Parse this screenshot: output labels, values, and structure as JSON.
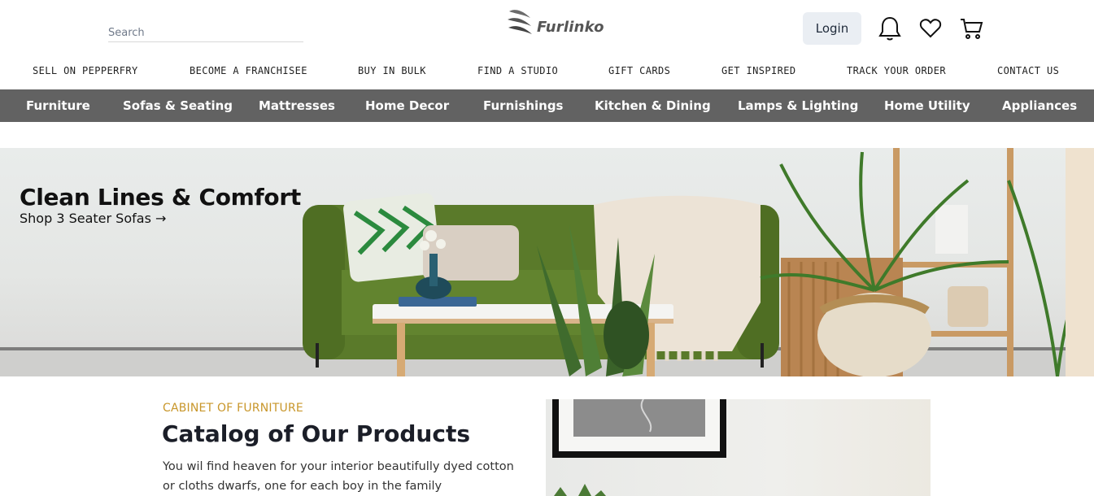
{
  "header": {
    "search_placeholder": "Search",
    "logo_text": "Furlinko",
    "login_label": "Login",
    "icons": [
      "bell-icon",
      "heart-icon",
      "cart-icon"
    ]
  },
  "top_links": [
    "SELL ON PEPPERFRY",
    "BECOME A FRANCHISEE",
    "BUY IN BULK",
    "FIND A STUDIO",
    "GIFT CARDS",
    "GET INSPIRED",
    "TRACK YOUR ORDER",
    "CONTACT US"
  ],
  "categories": [
    "Furniture",
    "Sofas & Seating",
    "Mattresses",
    "Home Decor",
    "Furnishings",
    "Kitchen & Dining",
    "Lamps & Lighting",
    "Home Utility",
    "Appliances"
  ],
  "hero": {
    "title": "Clean Lines & Comfort",
    "link_text": "Shop 3 Seater Sofas →"
  },
  "catalog": {
    "kicker": "CABINET OF FURNITURE",
    "title": "Catalog of Our Products",
    "description": "You wil find heaven for your interior beautifully dyed cotton or cloths dwarfs, one for each boy in the family"
  },
  "colors": {
    "category_bar": "#626262",
    "kicker_gold": "#c8962a",
    "login_bg": "#eaeef3"
  }
}
